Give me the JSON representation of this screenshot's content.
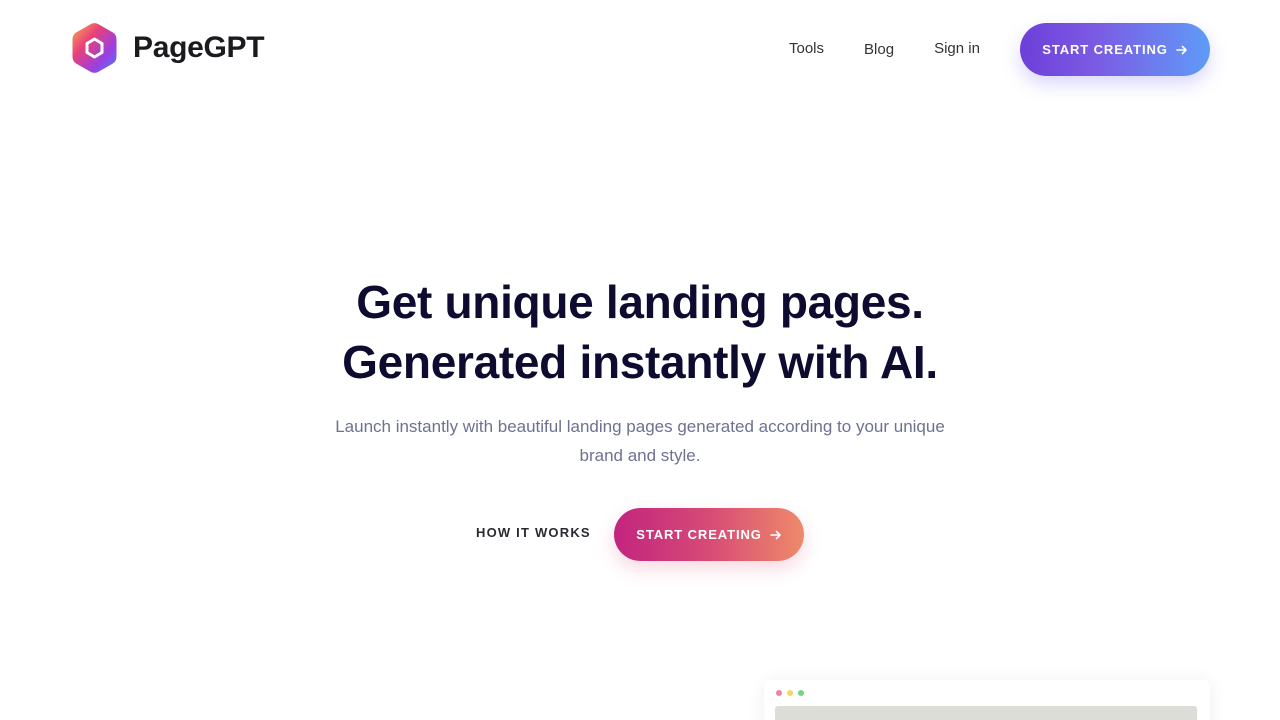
{
  "brand": {
    "name": "PageGPT",
    "logo_icon": "hexagon-logo-icon"
  },
  "nav": {
    "items": [
      {
        "label": "Tools"
      },
      {
        "label": "Blog"
      },
      {
        "label": "Sign in"
      }
    ],
    "cta_label": "START CREATING",
    "cta_icon": "arrow-right-icon"
  },
  "hero": {
    "title_line1": "Get unique landing pages.",
    "title_line2": "Generated instantly with AI.",
    "subtitle_line1": "Launch instantly with beautiful landing pages generated according to your unique",
    "subtitle_line2": "brand and style.",
    "secondary_label": "HOW IT WORKS",
    "primary_label": "START CREATING",
    "primary_icon": "arrow-right-icon"
  },
  "colors": {
    "title": "#0d0b30",
    "subtitle": "#6e7191",
    "top_cta_gradient": [
      "#6d3fd9",
      "#5f9bf8"
    ],
    "hero_cta_gradient": [
      "#c2247e",
      "#ef8a6a"
    ],
    "window_dots": [
      "#f0849e",
      "#f5d76b",
      "#76d38a"
    ]
  }
}
